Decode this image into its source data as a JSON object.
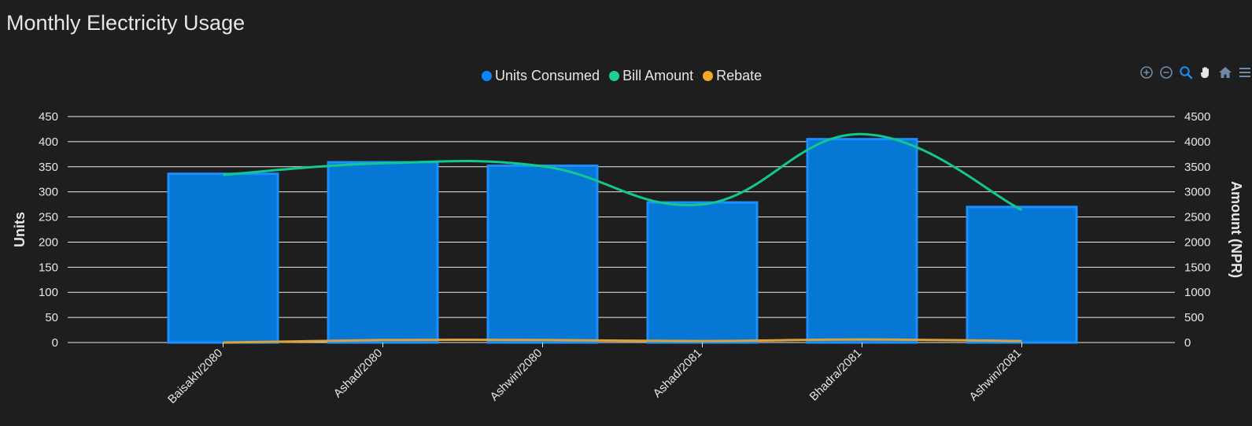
{
  "header": {
    "title": "Monthly Electricity Usage"
  },
  "toolbar": {
    "icons": [
      "zoom-in-icon",
      "zoom-out-icon",
      "selection-zoom-icon",
      "pan-hand-icon",
      "home-reset-icon",
      "menu-icon"
    ]
  },
  "colors": {
    "background": "#1e1e1e",
    "bar_fill": "#0777d5",
    "bar_stroke": "#1a8fff",
    "bill_line": "#11c98a",
    "rebate_line": "#d9a23a",
    "grid": "#e8e8e8",
    "text": "#e6e6e6",
    "toolbar_icon": "#6e8aa8",
    "toolbar_active": "#1a8fff"
  },
  "chart_data": {
    "type": "bar",
    "title": "Monthly Electricity Usage",
    "categories": [
      "Baisakh/2080",
      "Ashad/2080",
      "Ashwin/2080",
      "Ashad/2081",
      "Bhadra/2081",
      "Ashwin/2081"
    ],
    "series": [
      {
        "name": "Units Consumed",
        "type": "bar",
        "axis": "left",
        "color": "#0a84ff",
        "values": [
          336,
          359,
          352,
          279,
          405,
          270
        ]
      },
      {
        "name": "Bill Amount",
        "type": "line",
        "axis": "right",
        "color": "#1ed18f",
        "values": [
          3340,
          3570,
          3510,
          2750,
          4150,
          2640
        ]
      },
      {
        "name": "Rebate",
        "type": "line",
        "axis": "right",
        "color": "#f4a82a",
        "values": [
          0,
          50,
          50,
          30,
          60,
          30
        ]
      }
    ],
    "y_left": {
      "label": "Units",
      "min": 0,
      "max": 450,
      "ticks": [
        "0",
        "50",
        "100",
        "150",
        "200",
        "250",
        "300",
        "350",
        "400",
        "450"
      ]
    },
    "y_right": {
      "label": "Amount (NPR)",
      "min": 0,
      "max": 4500,
      "ticks": [
        "0",
        "500",
        "1000",
        "1500",
        "2000",
        "2500",
        "3000",
        "3500",
        "4000",
        "4500"
      ]
    },
    "grid": true,
    "legend_position": "top-center"
  }
}
